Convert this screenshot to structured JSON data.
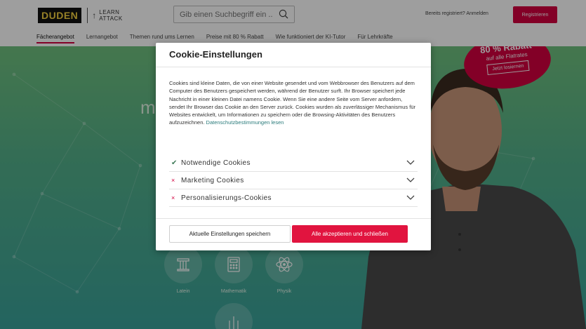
{
  "header": {
    "logo_duden": "DUDEN",
    "logo_la_1": "LEARN",
    "logo_la_2": "ATTACK",
    "search_placeholder": "Gib einen Suchbegriff ein ...",
    "registered_link": "Bereits registriert? Anmelden",
    "register_button": "Registrieren",
    "nav": [
      "Fächerangebot",
      "Lernangebot",
      "Themen rund ums Lernen",
      "Preise mit 80 % Rabatt",
      "Wie funktioniert der KI-Tutor",
      "Für Lehrkräfte"
    ]
  },
  "hero": {
    "heading_fragment": "m",
    "promo_title": "80 % Rabatt",
    "promo_sub": "auf alle Flatrates",
    "promo_button": "Jetzt losiernen",
    "subjects": [
      "Latein",
      "Mathematik",
      "Physik"
    ]
  },
  "modal": {
    "title": "Cookie-Einstellungen",
    "text": "Cookies sind kleine Daten, die von einer Website gesendet und vom Webbrowser des Benutzers auf dem Computer des Benutzers gespeichert werden, während der Benutzer surft. Ihr Browser speichert jede Nachricht in einer kleinen Datei namens Cookie. Wenn Sie eine andere Seite vom Server anfordern, sendet Ihr Browser das Cookie an den Server zurück. Cookies wurden als zuverlässiger Mechanismus für Websites entwickelt, um Informationen zu speichern oder die Browsing-Aktivitäten des Benutzers aufzuzeichnen.",
    "privacy_link": "Datenschutzbestimmungen lesen",
    "categories": [
      {
        "label": "Notwendige Cookies",
        "mark": "✔"
      },
      {
        "label": "Marketing Cookies",
        "mark": "×"
      },
      {
        "label": "Personalisierungs-Cookies",
        "mark": "×"
      }
    ],
    "save_button": "Aktuelle Einstellungen speichern",
    "accept_button": "Alle akzeptieren und schließen"
  },
  "colors": {
    "brand_red": "#d3003f",
    "accept_red": "#e1143f",
    "hero_green": "#53b08a",
    "check_green": "#3f7a58"
  }
}
